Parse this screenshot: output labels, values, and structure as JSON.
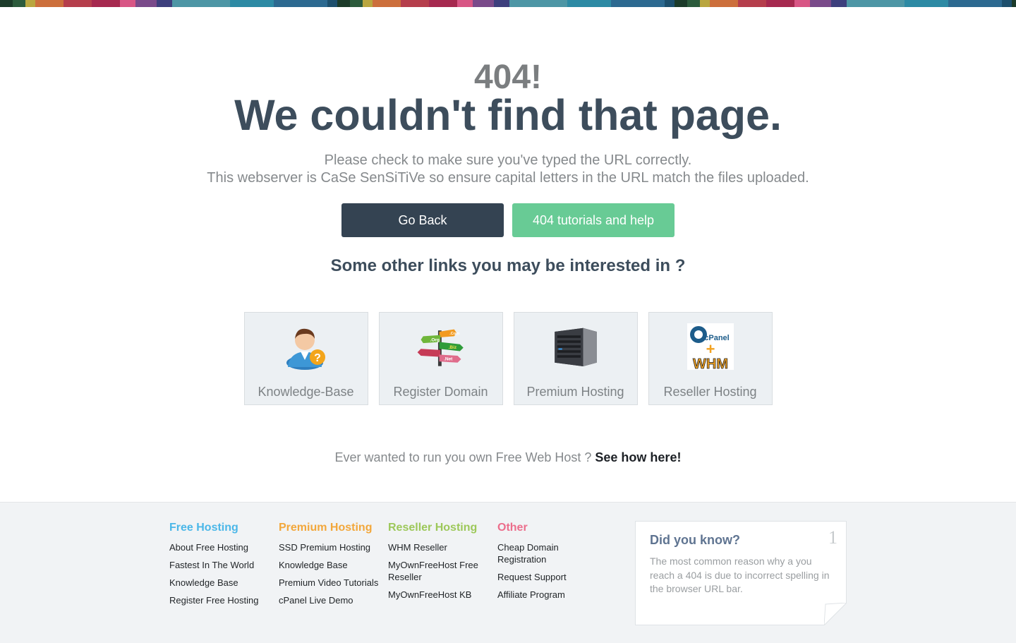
{
  "topbar_colors": [
    "#1c3b2a",
    "#2c5b3c",
    "#b9a63f",
    "#cc6f3c",
    "#b53e4c",
    "#a6294f",
    "#d85685",
    "#7a4a8a",
    "#3d3f7d",
    "#4d96a5",
    "#2d8aa4",
    "#2c6990",
    "#1d4f6d"
  ],
  "error": {
    "code": "404!",
    "headline": "We couldn't find that page.",
    "line1": "Please check to make sure you've typed the URL correctly.",
    "line2": "This webserver is CaSe SenSiTiVe so ensure capital letters in the URL match the files uploaded."
  },
  "buttons": {
    "back": "Go Back",
    "help": "404 tutorials and help"
  },
  "other_links_heading": "Some other links you may be interested in ?",
  "cards": [
    {
      "label": "Knowledge-Base",
      "icon": "support-person-icon"
    },
    {
      "label": "Register Domain",
      "icon": "domain-signpost-icon"
    },
    {
      "label": "Premium Hosting",
      "icon": "server-icon"
    },
    {
      "label": "Reseller Hosting",
      "icon": "cpanel-whm-icon"
    }
  ],
  "signpost_words": [
    ".Com",
    ".Org",
    ".Biz",
    ".Net"
  ],
  "cpanel_logo_text": [
    "cPanel",
    "+",
    "WHM"
  ],
  "run_host": {
    "text": "Ever wanted to run you own Free Web Host ?",
    "link": "See how here!"
  },
  "footer": {
    "columns": [
      {
        "title": "Free Hosting",
        "color": "#4bb7e8",
        "links": [
          "About Free Hosting",
          "Fastest In The World",
          "Knowledge Base",
          "Register Free Hosting"
        ]
      },
      {
        "title": "Premium Hosting",
        "color": "#f2a73b",
        "links": [
          "SSD Premium Hosting",
          "Knowledge Base",
          "Premium Video Tutorials",
          "cPanel Live Demo"
        ]
      },
      {
        "title": "Reseller Hosting",
        "color": "#9dc85a",
        "links": [
          "WHM Reseller",
          "MyOwnFreeHost Free Reseller",
          "MyOwnFreeHost KB"
        ]
      },
      {
        "title": "Other",
        "color": "#ec6e8c",
        "links": [
          "Cheap Domain Registration",
          "Request Support",
          "Affiliate Program"
        ]
      }
    ],
    "did_you_know": {
      "title": "Did you know?",
      "number": "1",
      "text": "The most common reason why a you reach a 404 is due to incorrect spelling in the browser URL bar."
    }
  }
}
